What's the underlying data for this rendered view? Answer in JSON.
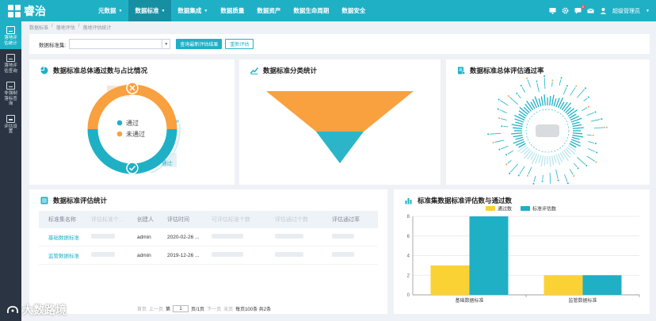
{
  "app": {
    "logo_text": "睿治"
  },
  "nav": [
    {
      "label": "元数据",
      "caret": true,
      "active": false
    },
    {
      "label": "数据标准",
      "caret": true,
      "active": true
    },
    {
      "label": "数据集成",
      "caret": true,
      "active": false
    },
    {
      "label": "数据质量",
      "caret": false,
      "active": false
    },
    {
      "label": "数据资产",
      "caret": false,
      "active": false
    },
    {
      "label": "数据生命周期",
      "caret": false,
      "active": false
    },
    {
      "label": "数据安全",
      "caret": false,
      "active": false
    }
  ],
  "topbar": {
    "user": "超级管理员",
    "badge": "2"
  },
  "sidebar": [
    {
      "label": "落地评估统计",
      "active": true
    },
    {
      "label": "落地评估查询",
      "active": false
    },
    {
      "label": "非强制落标查询",
      "active": false
    },
    {
      "label": "评估设置",
      "active": false
    }
  ],
  "breadcrumb": [
    "数据标准",
    "/",
    "落地评估",
    "/",
    "落地评估统计"
  ],
  "filter": {
    "label": "数据标准集:",
    "btn_query": "查询最新评估结果",
    "btn_reassess": "重新评估"
  },
  "cards": {
    "pass_ratio": {
      "title": "数据标准总体通过数与占比情况",
      "legend_pass": "通过",
      "legend_fail": "未通过",
      "tooltip": "通过:"
    },
    "category": {
      "title": "数据标准分类统计"
    },
    "pass_rate": {
      "title": "数据标准总体评估通过率"
    },
    "table": {
      "title": "数据标准评估统计",
      "headers": [
        "标准集名称",
        "评估标准个...",
        "创建人",
        "评估时间",
        "可评估标准个数",
        "评估通过个数",
        "评估通过率"
      ],
      "rows": [
        {
          "name": "基础数据标准",
          "creator": "admin",
          "time": "2020-02-26 ..."
        },
        {
          "name": "监管数据标准",
          "creator": "admin",
          "time": "2019-12-26 ..."
        }
      ],
      "pager": {
        "first": "首页",
        "prev": "上一页",
        "page_prefix": "第",
        "page": "1",
        "page_suffix": "页/1页",
        "next": "下一页",
        "last": "末页",
        "summary": "每页100条 共2条"
      }
    },
    "bar": {
      "title": "标准集数据标准评估数与通过数"
    }
  },
  "chart_data": {
    "type": "bar",
    "categories": [
      "基础数据标准",
      "监管数据标准"
    ],
    "series": [
      {
        "name": "通过数",
        "values": [
          3,
          2
        ]
      },
      {
        "name": "标准评估数",
        "values": [
          8,
          2
        ]
      }
    ],
    "ylim": [
      0,
      8
    ],
    "yticks": [
      0,
      2,
      4,
      6,
      8
    ],
    "legend": "top-center",
    "colors": [
      "#fbd234",
      "#1fb0c6"
    ]
  },
  "colors": {
    "brand": "#1fb0c6",
    "orange": "#f9a03f",
    "sidebar": "#2b3443"
  },
  "watermark": "大数路境"
}
